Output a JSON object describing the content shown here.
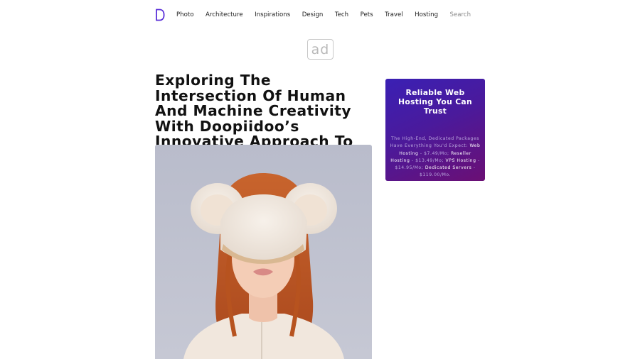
{
  "logo": {
    "letter": "D",
    "color": "#5a2fd8"
  },
  "nav": {
    "items": [
      {
        "label": "Photo",
        "name": "photo"
      },
      {
        "label": "Architecture",
        "name": "architecture"
      },
      {
        "label": "Inspirations",
        "name": "inspirations"
      },
      {
        "label": "Design",
        "name": "design"
      },
      {
        "label": "Tech",
        "name": "tech"
      },
      {
        "label": "Pets",
        "name": "pets"
      },
      {
        "label": "Travel",
        "name": "travel"
      },
      {
        "label": "Hosting",
        "name": "hosting"
      }
    ],
    "search_placeholder": "Search"
  },
  "ad": {
    "label": "ad"
  },
  "article": {
    "title": "Exploring The Intersection Of Human And Machine Creativity With Doopiidoo’s Innovative Approach To Art"
  },
  "promo": {
    "title": "Reliable Web Hosting You Can Trust",
    "intro": "The High-End, Dedicated Packages Have Everything You'd Expect:",
    "items": [
      {
        "name": "Web Hosting",
        "price": " - $7.49/Mo;"
      },
      {
        "name": "Reseller Hosting",
        "price": " - $13.49/Mo;"
      },
      {
        "name": "VPS Hosting",
        "price": " - $14.95/Mo;"
      },
      {
        "name": "Dedicated Servers",
        "price": " - $119.00/Mo."
      }
    ],
    "colors": {
      "gradient_start": "#3a20b4",
      "gradient_end": "#6b0f74"
    }
  }
}
